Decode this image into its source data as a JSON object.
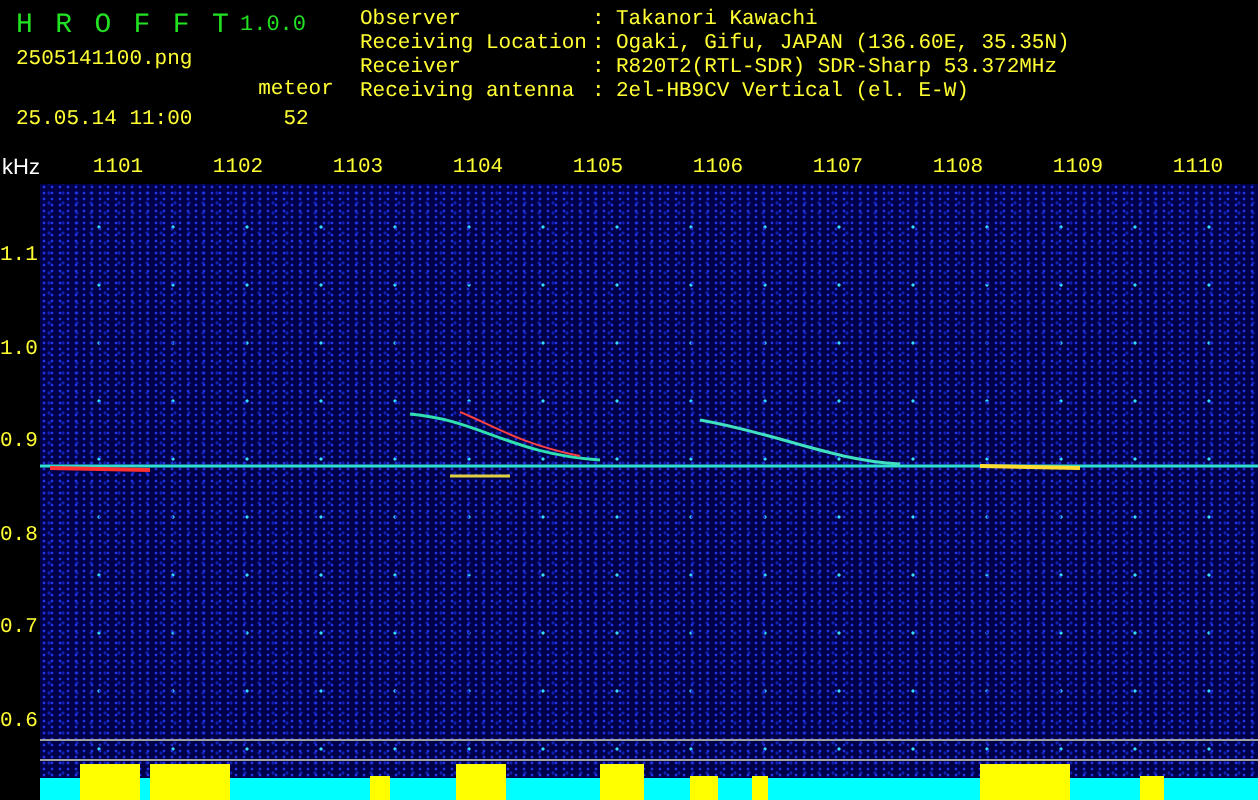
{
  "app": {
    "name": "H R O F F T",
    "version": "1.0.0"
  },
  "file": "2505141100.png",
  "datetime": "25.05.14 11:00",
  "meteor": {
    "label": "meteor",
    "count": "52"
  },
  "info": [
    {
      "label": "Observer",
      "separator": ":",
      "value": "Takanori Kawachi"
    },
    {
      "label": "Receiving Location",
      "separator": ":",
      "value": "Ogaki, Gifu, JAPAN (136.60E, 35.35N)"
    },
    {
      "label": "Receiver",
      "separator": ":",
      "value": "R820T2(RTL-SDR) SDR-Sharp 53.372MHz"
    },
    {
      "label": "Receiving antenna",
      "separator": ":",
      "value": "2el-HB9CV Vertical (el. E-W)"
    }
  ],
  "spectrogram": {
    "y_unit": "kHz",
    "x_labels": [
      "1101",
      "1102",
      "1103",
      "1104",
      "1105",
      "1106",
      "1107",
      "1108",
      "1109",
      "1110"
    ],
    "y_labels": [
      "1.1",
      "1.0",
      "0.9",
      "0.8",
      "0.7",
      "0.6"
    ]
  }
}
